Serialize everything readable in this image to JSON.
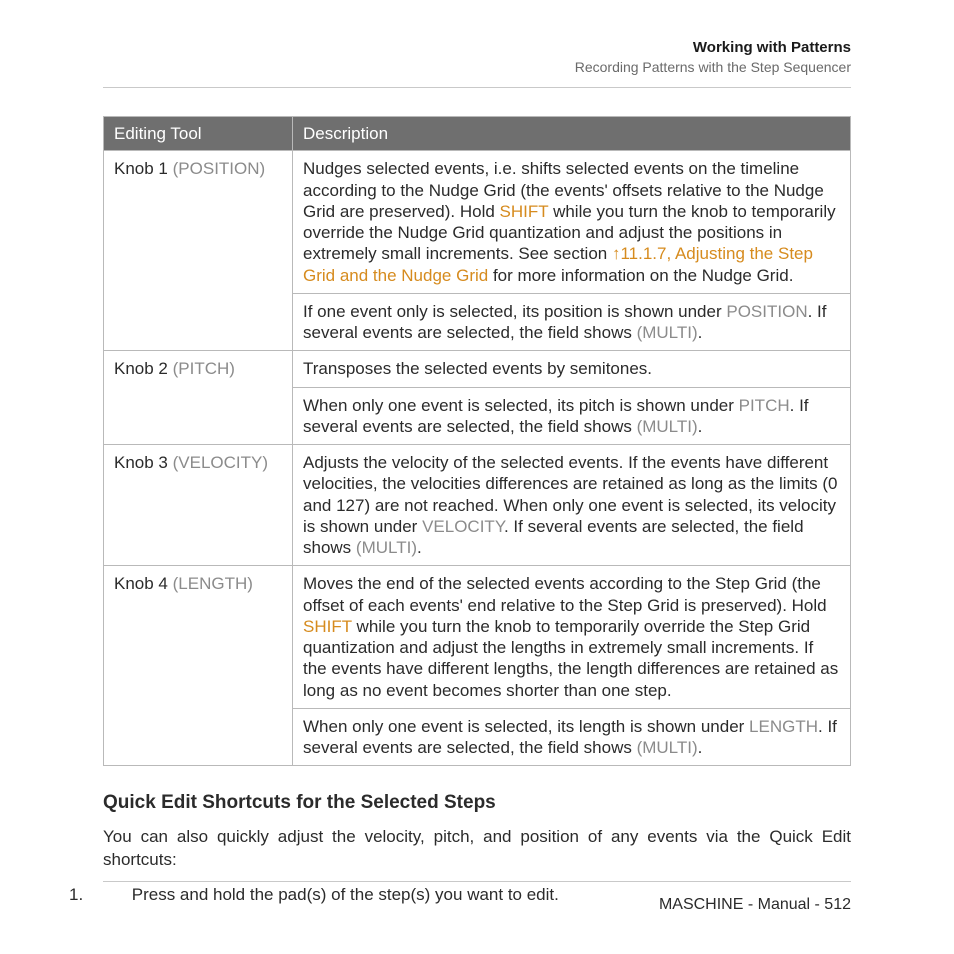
{
  "header": {
    "title": "Working with Patterns",
    "subtitle": "Recording Patterns with the Step Sequencer"
  },
  "table": {
    "columns": {
      "tool": "Editing Tool",
      "desc": "Description"
    },
    "rows": [
      {
        "knob": "Knob 1",
        "param": "POSITION",
        "p1_a": "Nudges selected events, i.e. shifts selected events on the timeline according to the Nudge Grid (the events' offsets relative to the Nudge Grid are preserved). Hold ",
        "p1_shift": "SHIFT",
        "p1_b": " while you turn the knob to temporarily override the Nudge Grid quantization and adjust the positions in extremely small increments. See section ",
        "p1_link": "↑11.1.7, Adjusting the Step Grid and the Nudge Grid",
        "p1_c": " for more information on the Nudge Grid.",
        "p2_a": "If one event only is selected, its position is shown under ",
        "p2_l1": "POSITION",
        "p2_b": ". If several events are selected, the field shows ",
        "p2_l2": "(MULTI)",
        "p2_c": "."
      },
      {
        "knob": "Knob 2",
        "param": "PITCH",
        "p1_a": "Transposes the selected events by semitones.",
        "p2_a": "When only one event is selected, its pitch is shown under ",
        "p2_l1": "PITCH",
        "p2_b": ". If several events are selected, the field shows ",
        "p2_l2": "(MULTI)",
        "p2_c": "."
      },
      {
        "knob": "Knob 3",
        "param": "VELOCITY",
        "p1_a": "Adjusts the velocity of the selected events. If the events have different velocities, the velocities differences are retained as long as the limits (0 and 127) are not reached. When only one event is selected, its velocity is shown under ",
        "p1_l1": "VELOCITY",
        "p1_b": ". If several events are selected, the field shows ",
        "p1_l2": "(MULTI)",
        "p1_c": "."
      },
      {
        "knob": "Knob 4",
        "param": "LENGTH",
        "p1_a": "Moves the end of the selected events according to the Step Grid (the offset of each events' end relative to the Step Grid is preserved). Hold ",
        "p1_shift": "SHIFT",
        "p1_b": " while you turn the knob to temporarily override the Step Grid quantization and adjust the lengths in extremely small increments. If the events have different lengths, the length differences are retained as long as no event becomes shorter than one step.",
        "p2_a": "When only one event is selected, its length is shown under ",
        "p2_l1": "LENGTH",
        "p2_b": ". If several events are selected, the field shows ",
        "p2_l2": "(MULTI)",
        "p2_c": "."
      }
    ]
  },
  "section": {
    "heading": "Quick Edit Shortcuts for the Selected Steps",
    "intro": "You can also quickly adjust the velocity, pitch, and position of any events via the Quick Edit shortcuts:",
    "step_index": "1.",
    "step_text": "Press and hold the pad(s) of the step(s) you want to edit."
  },
  "footer": {
    "text": "MASCHINE - Manual - 512"
  }
}
